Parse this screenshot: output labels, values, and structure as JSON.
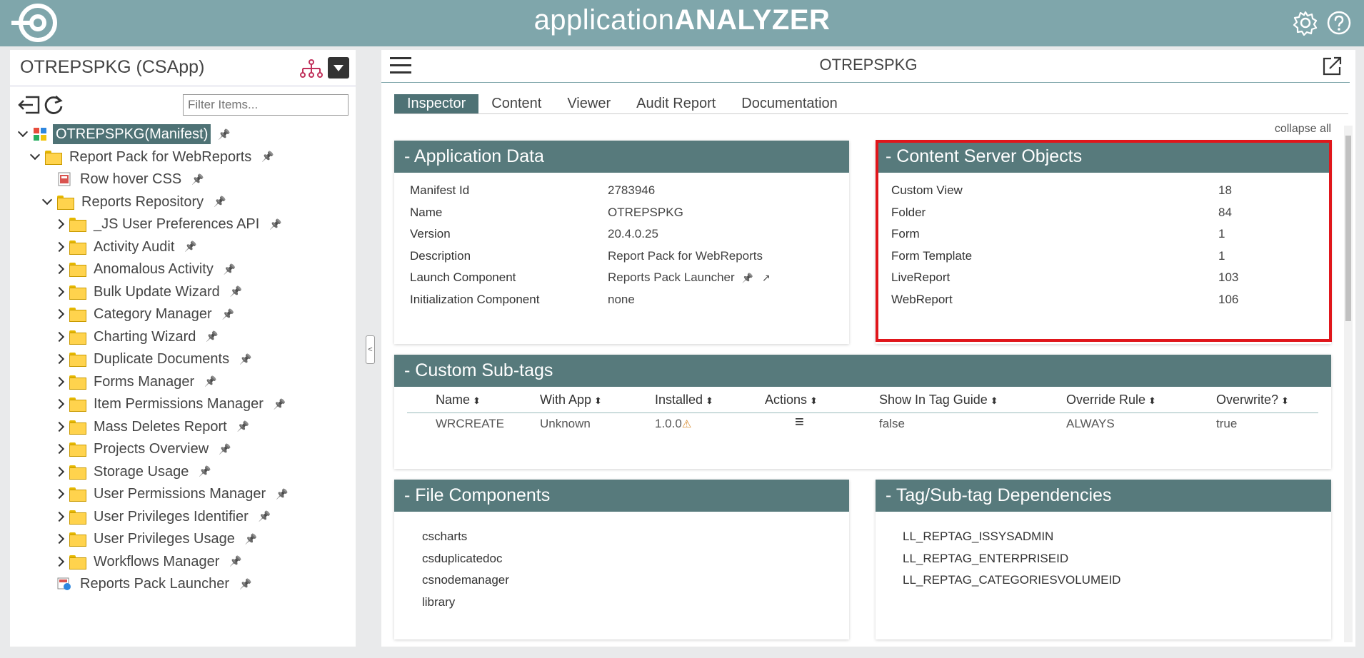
{
  "header": {
    "title_light": "application",
    "title_bold": "ANALYZER",
    "settings_icon": "gear-icon",
    "help_icon": "help-icon"
  },
  "left": {
    "title": "OTREPSPKG (CSApp)",
    "filter_placeholder": "Filter Items...",
    "tree": [
      {
        "label": "OTREPSPKG(Manifest)",
        "type": "manifest",
        "expand": "down",
        "depth": 0,
        "selected": true
      },
      {
        "label": "Report Pack for WebReports",
        "type": "folder",
        "expand": "down",
        "depth": 1
      },
      {
        "label": "Row hover CSS",
        "type": "css",
        "expand": "none",
        "depth": 2
      },
      {
        "label": "Reports Repository",
        "type": "folder",
        "expand": "down",
        "depth": 2
      },
      {
        "label": "_JS User Preferences API",
        "type": "folder",
        "expand": "right",
        "depth": 3
      },
      {
        "label": "Activity Audit",
        "type": "folder",
        "expand": "right",
        "depth": 3
      },
      {
        "label": "Anomalous Activity",
        "type": "folder",
        "expand": "right",
        "depth": 3
      },
      {
        "label": "Bulk Update Wizard",
        "type": "folder",
        "expand": "right",
        "depth": 3
      },
      {
        "label": "Category Manager",
        "type": "folder",
        "expand": "right",
        "depth": 3
      },
      {
        "label": "Charting Wizard",
        "type": "folder",
        "expand": "right",
        "depth": 3
      },
      {
        "label": "Duplicate Documents",
        "type": "folder",
        "expand": "right",
        "depth": 3
      },
      {
        "label": "Forms Manager",
        "type": "folder",
        "expand": "right",
        "depth": 3
      },
      {
        "label": "Item Permissions Manager",
        "type": "folder",
        "expand": "right",
        "depth": 3
      },
      {
        "label": "Mass Deletes Report",
        "type": "folder",
        "expand": "right",
        "depth": 3
      },
      {
        "label": "Projects Overview",
        "type": "folder",
        "expand": "right",
        "depth": 3
      },
      {
        "label": "Storage Usage",
        "type": "folder",
        "expand": "right",
        "depth": 3
      },
      {
        "label": "User Permissions Manager",
        "type": "folder",
        "expand": "right",
        "depth": 3
      },
      {
        "label": "User Privileges Identifier",
        "type": "folder",
        "expand": "right",
        "depth": 3
      },
      {
        "label": "User Privileges Usage",
        "type": "folder",
        "expand": "right",
        "depth": 3
      },
      {
        "label": "Workflows Manager",
        "type": "folder",
        "expand": "right",
        "depth": 3
      },
      {
        "label": "Reports Pack Launcher",
        "type": "launcher",
        "expand": "none",
        "depth": 2
      }
    ]
  },
  "main": {
    "title": "OTREPSPKG",
    "tabs": [
      "Inspector",
      "Content",
      "Viewer",
      "Audit Report",
      "Documentation"
    ],
    "collapse_all": "collapse all",
    "app_data": {
      "title": "- Application Data",
      "rows": [
        {
          "key": "Manifest Id",
          "value": "2783946"
        },
        {
          "key": "Name",
          "value": "OTREPSPKG"
        },
        {
          "key": "Version",
          "value": "20.4.0.25"
        },
        {
          "key": "Description",
          "value": "Report Pack for WebReports"
        },
        {
          "key": "Launch Component",
          "value": "Reports Pack Launcher"
        },
        {
          "key": "Initialization Component",
          "value": "none"
        }
      ]
    },
    "cs_objects": {
      "title": "- Content Server Objects",
      "rows": [
        {
          "key": "Custom View",
          "value": "18"
        },
        {
          "key": "Folder",
          "value": "84"
        },
        {
          "key": "Form",
          "value": "1"
        },
        {
          "key": "Form Template",
          "value": "1"
        },
        {
          "key": "LiveReport",
          "value": "103"
        },
        {
          "key": "WebReport",
          "value": "106"
        }
      ]
    },
    "subtags": {
      "title": "- Custom Sub-tags",
      "columns": [
        "Name",
        "With App",
        "Installed",
        "Actions",
        "Show In Tag Guide",
        "Override Rule",
        "Overwrite?"
      ],
      "rows": [
        {
          "name": "WRCREATE",
          "with_app": "Unknown",
          "installed": "1.0.0",
          "show": "false",
          "override": "ALWAYS",
          "overwrite": "true"
        }
      ]
    },
    "file_components": {
      "title": "- File Components",
      "items": [
        "cscharts",
        "csduplicatedoc",
        "csnodemanager",
        "library"
      ]
    },
    "dependencies": {
      "title": "- Tag/Sub-tag Dependencies",
      "items": [
        "LL_REPTAG_ISSYSADMIN",
        "LL_REPTAG_ENTERPRISEID",
        "LL_REPTAG_CATEGORIESVOLUMEID"
      ]
    }
  }
}
